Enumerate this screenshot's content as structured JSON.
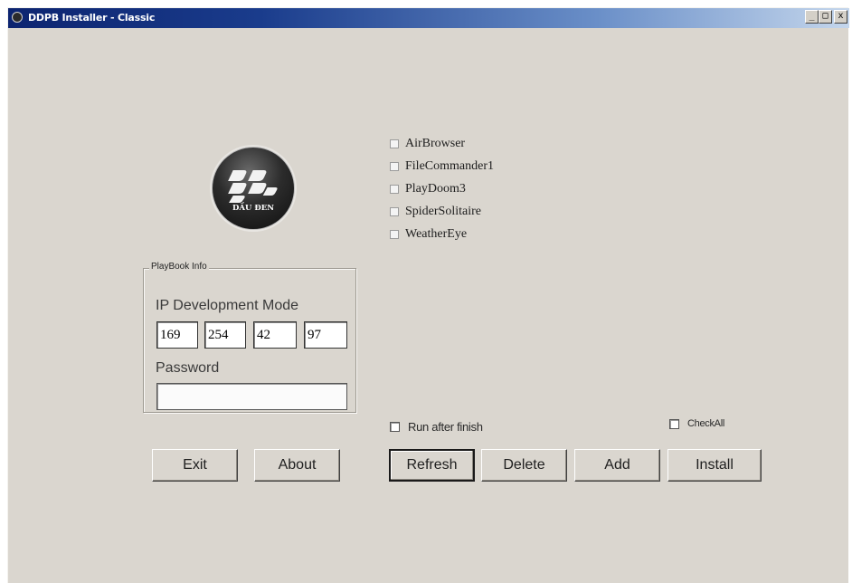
{
  "window": {
    "title": "DDPB Installer - Classic",
    "controls": {
      "minimize": "_",
      "maximize": "□",
      "close": "x"
    }
  },
  "logo": {
    "text": "DẦU ĐEN",
    "icon": "blackberry-logo"
  },
  "apps": [
    {
      "label": "AirBrowser",
      "checked": false
    },
    {
      "label": "FileCommander1",
      "checked": false
    },
    {
      "label": "PlayDoom3",
      "checked": false
    },
    {
      "label": "SpiderSolitaire",
      "checked": false
    },
    {
      "label": "WeatherEye",
      "checked": false
    }
  ],
  "playbook_info": {
    "group_label": "PlayBook Info",
    "ip_label": "IP Development Mode",
    "ip": [
      "169",
      "254",
      "42",
      "97"
    ],
    "password_label": "Password",
    "password_value": ""
  },
  "options": {
    "run_after_finish": {
      "label": "Run after finish",
      "checked": false
    },
    "check_all": {
      "label": "CheckAll",
      "checked": false
    }
  },
  "buttons": {
    "exit": "Exit",
    "about": "About",
    "refresh": "Refresh",
    "delete": "Delete",
    "add": "Add",
    "install": "Install"
  }
}
